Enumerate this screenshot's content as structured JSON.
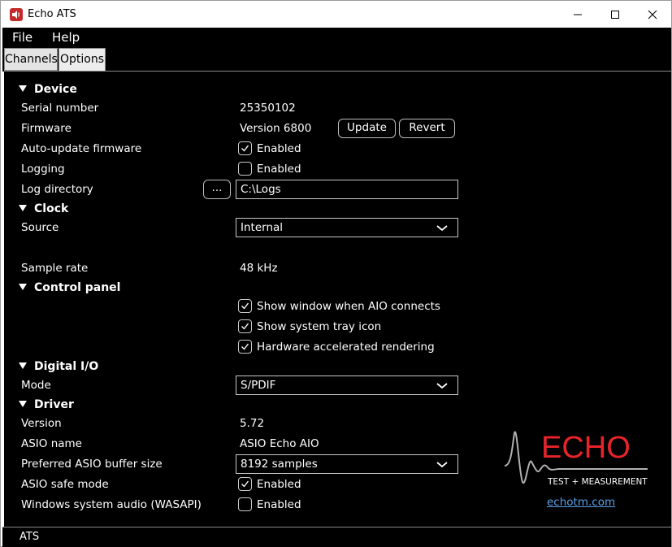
{
  "window": {
    "title": "Echo ATS"
  },
  "menu": {
    "file": "File",
    "help": "Help"
  },
  "tabs": {
    "channels": "Channels",
    "options": "Options"
  },
  "device": {
    "heading": "Device",
    "serial_label": "Serial number",
    "serial_value": "25350102",
    "firmware_label": "Firmware",
    "firmware_value": "Version 6800",
    "update_button": "Update",
    "revert_button": "Revert",
    "auto_update_label": "Auto-update firmware",
    "auto_update_checked": true,
    "auto_update_text": "Enabled",
    "logging_label": "Logging",
    "logging_checked": false,
    "logging_text": "Enabled",
    "log_dir_label": "Log directory",
    "browse_button": "...",
    "log_dir_value": "C:\\Logs"
  },
  "clock": {
    "heading": "Clock",
    "source_label": "Source",
    "source_value": "Internal",
    "sample_rate_label": "Sample rate",
    "sample_rate_value": "48 kHz"
  },
  "control_panel": {
    "heading": "Control panel",
    "options": [
      {
        "label": "Show window when AIO connects",
        "checked": true
      },
      {
        "label": "Show system tray icon",
        "checked": true
      },
      {
        "label": "Hardware accelerated rendering",
        "checked": true
      }
    ]
  },
  "digital_io": {
    "heading": "Digital I/O",
    "mode_label": "Mode",
    "mode_value": "S/PDIF"
  },
  "driver": {
    "heading": "Driver",
    "version_label": "Version",
    "version_value": "5.72",
    "asio_name_label": "ASIO name",
    "asio_name_value": "ASIO Echo AIO",
    "buffer_label": "Preferred ASIO buffer size",
    "buffer_value": "8192 samples",
    "safe_mode_label": "ASIO safe mode",
    "safe_mode_checked": true,
    "safe_mode_text": "Enabled",
    "wasapi_label": "Windows system audio (WASAPI)",
    "wasapi_checked": false,
    "wasapi_text": "Enabled"
  },
  "logo": {
    "brand": "ECHO",
    "tagline": "TEST + MEASUREMENT",
    "link": "echotm.com",
    "brand_color": "#e8232a"
  },
  "status": {
    "text": "ATS"
  }
}
